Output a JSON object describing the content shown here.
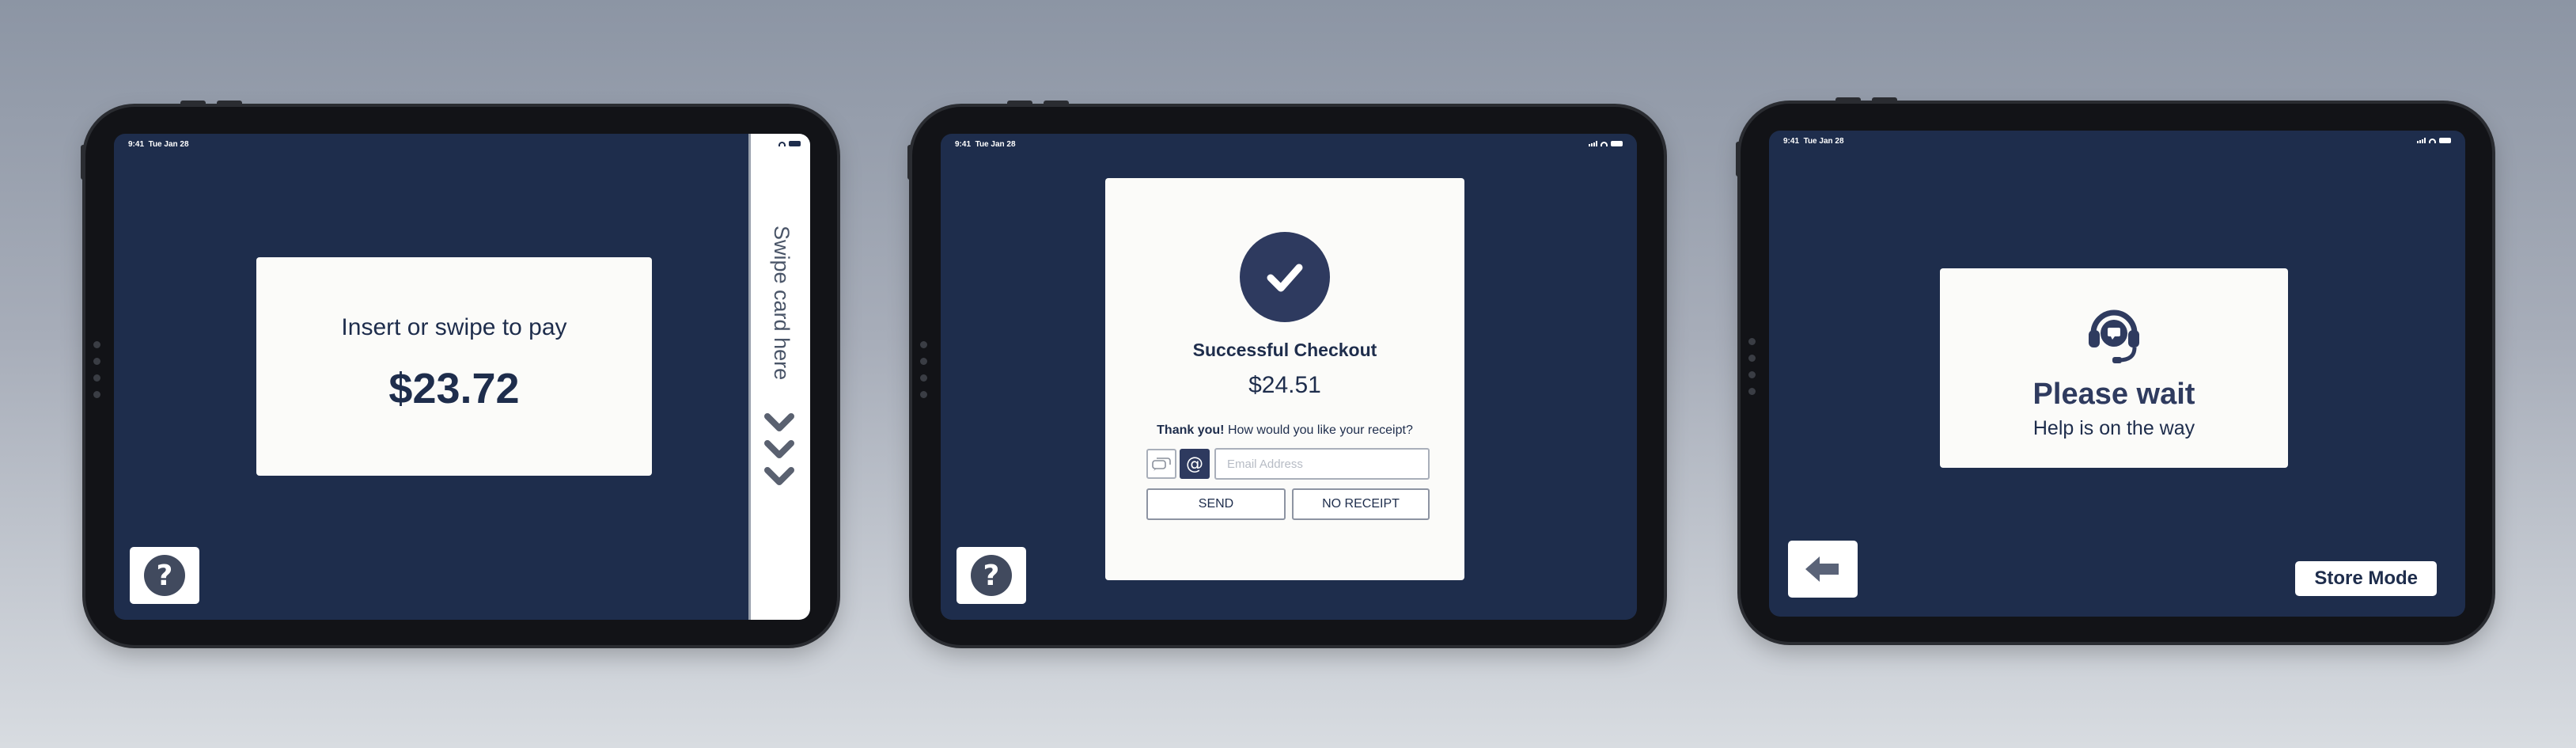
{
  "screens": [
    {
      "status": {
        "time": "9:41",
        "date": "Tue Jan 28"
      },
      "prompt": "Insert or swipe to pay",
      "amount": "$23.72",
      "swipe_label": "Swipe card here",
      "help_icon": "question-mark-icon"
    },
    {
      "status": {
        "time": "9:41",
        "date": "Tue Jan 28"
      },
      "title": "Successful Checkout",
      "amount": "$24.51",
      "thank_you": "Thank you!",
      "receipt_question": "How would you like your receipt?",
      "email_placeholder": "Email Address",
      "send_label": "SEND",
      "no_receipt_label": "NO RECEIPT",
      "receipt_options": [
        "sms-icon",
        "email-at-icon"
      ],
      "selected_option": "email-at-icon",
      "help_icon": "question-mark-icon"
    },
    {
      "status": {
        "time": "9:41",
        "date": "Tue Jan 28"
      },
      "title": "Please wait",
      "subtitle": "Help is on the way",
      "icon": "support-headset-icon",
      "back_icon": "arrow-left-icon",
      "store_mode_label": "Store Mode"
    }
  ],
  "colors": {
    "screen_bg": "#1e2d4c",
    "card_bg": "#fbfbf9",
    "accent_dark": "#2e3a5f",
    "help_circle": "#414a5e"
  }
}
